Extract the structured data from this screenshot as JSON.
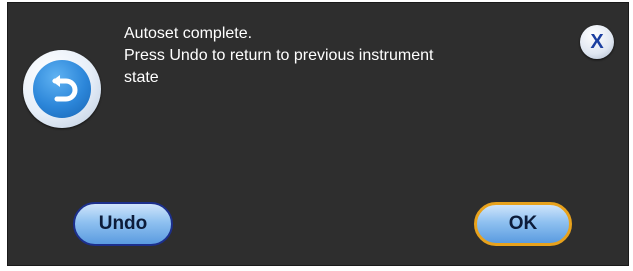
{
  "dialog": {
    "message_lines": [
      "Autoset complete.",
      "Press Undo to return to previous instrument",
      "state"
    ],
    "close_label": "X",
    "undo_label": "Undo",
    "ok_label": "OK",
    "icon": "undo-arrow-icon"
  },
  "colors": {
    "dialog_background": "#2e2e2e",
    "text": "#ffffff",
    "button_blue": "#8fc1f0",
    "ok_focus_border": "#e8a21c",
    "undo_border": "#1c2f8c",
    "close_x": "#1b3fa0"
  }
}
